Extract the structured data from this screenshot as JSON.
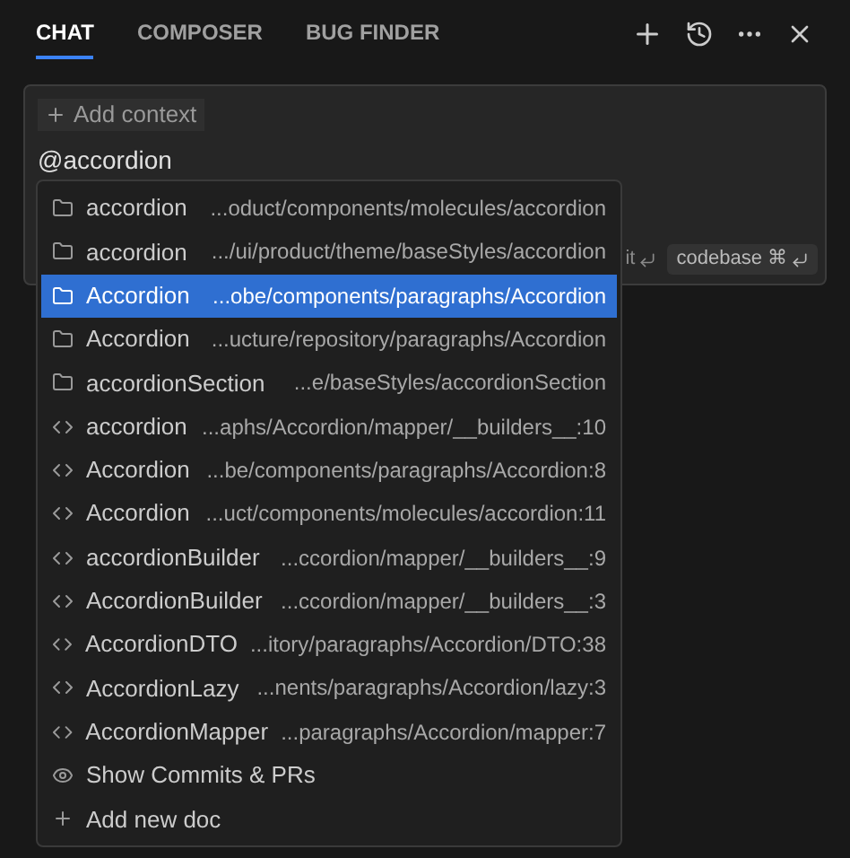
{
  "tabs": [
    {
      "label": "CHAT",
      "selected": true
    },
    {
      "label": "COMPOSER",
      "selected": false
    },
    {
      "label": "BUG FINDER",
      "selected": false
    }
  ],
  "input": {
    "context_button": "Add context",
    "value": "@accordion",
    "submit_hint": "it",
    "codebase_chip": "codebase ⌘"
  },
  "suggestions": [
    {
      "kind": "folder",
      "name": "accordion",
      "path": "...oduct/components/molecules/accordion",
      "selected": false
    },
    {
      "kind": "folder",
      "name": "accordion",
      "path": ".../ui/product/theme/baseStyles/accordion",
      "selected": false
    },
    {
      "kind": "folder",
      "name": "Accordion",
      "path": "...obe/components/paragraphs/Accordion",
      "selected": true
    },
    {
      "kind": "folder",
      "name": "Accordion",
      "path": "...ucture/repository/paragraphs/Accordion",
      "selected": false
    },
    {
      "kind": "folder",
      "name": "accordionSection",
      "path": "...e/baseStyles/accordionSection",
      "selected": false
    },
    {
      "kind": "code",
      "name": "accordion",
      "path": "...aphs/Accordion/mapper/__builders__:10",
      "selected": false
    },
    {
      "kind": "code",
      "name": "Accordion",
      "path": "...be/components/paragraphs/Accordion:8",
      "selected": false
    },
    {
      "kind": "code",
      "name": "Accordion",
      "path": "...uct/components/molecules/accordion:11",
      "selected": false
    },
    {
      "kind": "code",
      "name": "accordionBuilder",
      "path": "...ccordion/mapper/__builders__:9",
      "selected": false
    },
    {
      "kind": "code",
      "name": "AccordionBuilder",
      "path": "...ccordion/mapper/__builders__:3",
      "selected": false
    },
    {
      "kind": "code",
      "name": "AccordionDTO",
      "path": "...itory/paragraphs/Accordion/DTO:38",
      "selected": false
    },
    {
      "kind": "code",
      "name": "AccordionLazy",
      "path": "...nents/paragraphs/Accordion/lazy:3",
      "selected": false
    },
    {
      "kind": "code",
      "name": "AccordionMapper",
      "path": "...paragraphs/Accordion/mapper:7",
      "selected": false
    },
    {
      "kind": "commits",
      "name": "Show Commits & PRs",
      "selected": false
    },
    {
      "kind": "add",
      "name": "Add new doc",
      "selected": false
    }
  ]
}
